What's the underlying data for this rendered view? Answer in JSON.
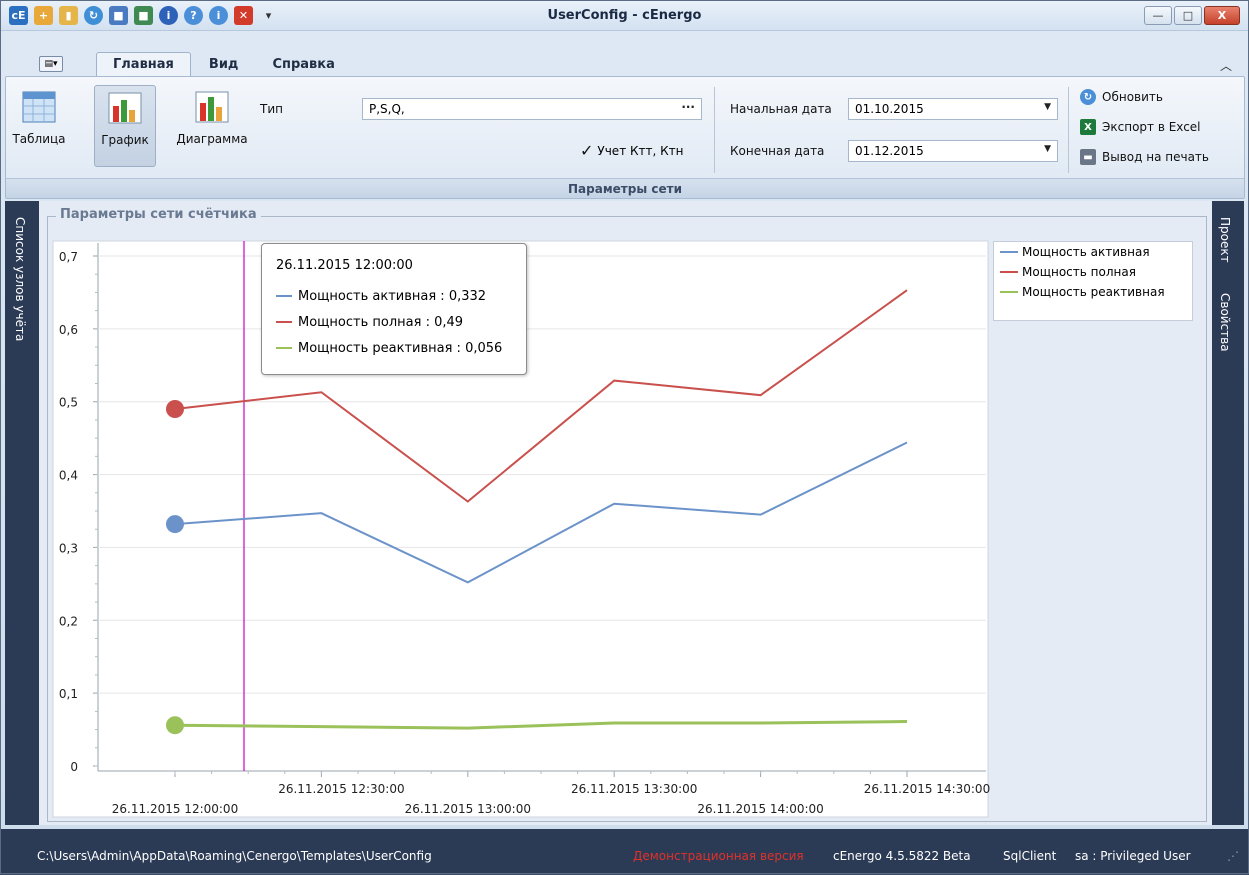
{
  "window": {
    "title": "UserConfig - cEnergo",
    "app_icon": "cE",
    "minimize": "—",
    "maximize": "□",
    "close": "X"
  },
  "ribbon_tabs": [
    {
      "label": "Главная",
      "active": true
    },
    {
      "label": "Вид",
      "active": false
    },
    {
      "label": "Справка",
      "active": false
    }
  ],
  "ribbon": {
    "view_buttons": [
      {
        "label": "Таблица",
        "icon": "table-icon",
        "selected": false
      },
      {
        "label": "График",
        "icon": "line-chart-icon",
        "selected": true
      },
      {
        "label": "Диаграмма",
        "icon": "bar-chart-icon",
        "selected": false
      }
    ],
    "type_label": "Тип",
    "type_value": "P,S,Q,",
    "type_button": "···",
    "ktt_checkbox": {
      "label": "Учет Ктт, Ктн",
      "checked": true,
      "mark": "✓"
    },
    "start_date_label": "Начальная дата",
    "start_date_value": "01.10.2015",
    "end_date_label": "Конечная дата",
    "end_date_value": "01.12.2015",
    "dropdown_arrow": "▼",
    "refresh_label": "Обновить",
    "excel_label": "Экспорт в Excel",
    "print_label": "Вывод на печать",
    "group_label": "Параметры сети"
  },
  "side_left": {
    "label": "Список узлов учёта"
  },
  "side_right": {
    "project_label": "Проект",
    "properties_label": "Свойства"
  },
  "panel": {
    "title": "Параметры сети счётчика"
  },
  "colors": {
    "active": "#6b93c9",
    "full": "#c9504c",
    "reactive": "#9bc15a",
    "crosshair": "#cc00cc"
  },
  "chart_data": {
    "type": "line",
    "x": [
      "26.11.2015 12:00:00",
      "26.11.2015 12:30:00",
      "26.11.2015 13:00:00",
      "26.11.2015 13:30:00",
      "26.11.2015 14:00:00",
      "26.11.2015 14:30:00"
    ],
    "series": [
      {
        "name": "Мощность активная",
        "values": [
          0.332,
          0.347,
          0.252,
          0.36,
          0.345,
          0.444
        ]
      },
      {
        "name": "Мощность полная",
        "values": [
          0.49,
          0.513,
          0.363,
          0.529,
          0.509,
          0.653
        ]
      },
      {
        "name": "Мощность реактивная",
        "values": [
          0.056,
          0.054,
          0.052,
          0.059,
          0.059,
          0.061
        ]
      }
    ],
    "ylim": [
      0,
      0.7
    ],
    "y_ticks": [
      "0",
      "0,1",
      "0,2",
      "0,3",
      "0,4",
      "0,5",
      "0,6",
      "0,7"
    ],
    "grid": true,
    "legend": "top-right",
    "highlight_index": 0
  },
  "tooltip": {
    "title": "26.11.2015 12:00:00",
    "rows": [
      "Мощность активная : 0,332",
      "Мощность полная : 0,49",
      "Мощность реактивная : 0,056"
    ]
  },
  "statusbar": {
    "path": "C:\\Users\\Admin\\AppData\\Roaming\\Cenergo\\Templates\\UserConfig",
    "demo": "Демонстрационная версия",
    "version": "cEnergo 4.5.5822 Beta",
    "client": "SqlClient",
    "user": "sa : Privileged User"
  }
}
